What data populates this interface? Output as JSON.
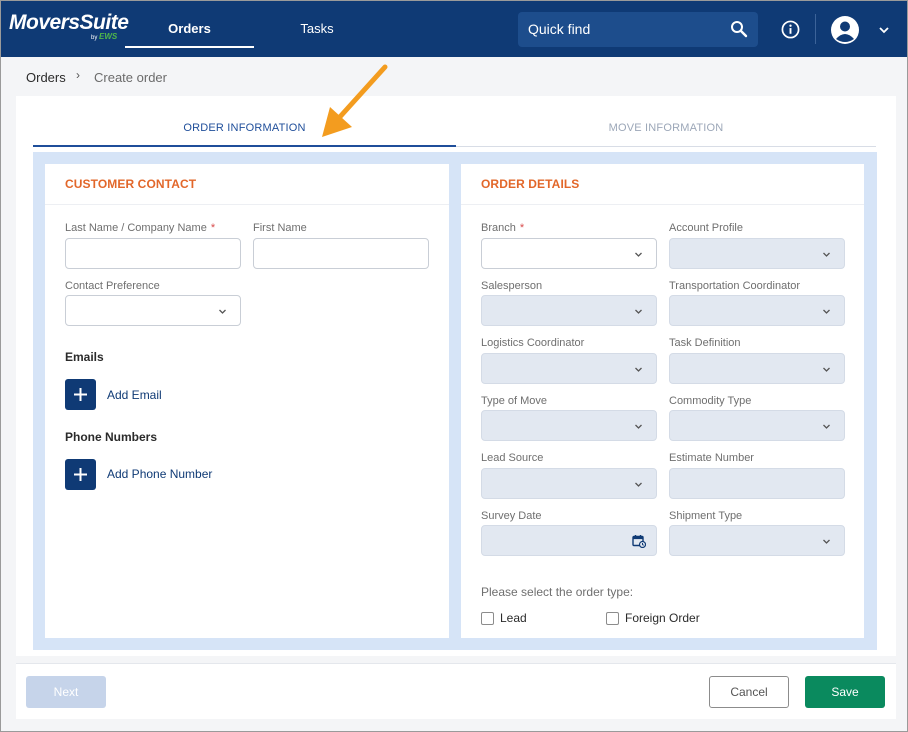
{
  "app": {
    "logo_text": "MoversSuite",
    "logo_sub_by": "by",
    "logo_sub_brand": "EWS"
  },
  "nav": {
    "tabs": [
      {
        "label": "Orders",
        "active": true
      },
      {
        "label": "Tasks",
        "active": false
      }
    ],
    "quick_find": "Quick find",
    "icons": [
      "search-icon",
      "info-icon",
      "user-avatar-icon",
      "chevron-down-icon"
    ]
  },
  "breadcrumb": {
    "root": "Orders",
    "separator": "›",
    "current": "Create order"
  },
  "tabs": [
    {
      "label": "ORDER INFORMATION",
      "active": true
    },
    {
      "label": "MOVE INFORMATION",
      "active": false
    }
  ],
  "customer_contact": {
    "title": "CUSTOMER CONTACT",
    "last_name_label": "Last Name / Company Name",
    "first_name_label": "First Name",
    "contact_pref_label": "Contact Preference",
    "required_marker": "*",
    "emails_heading": "Emails",
    "add_email": "Add Email",
    "phones_heading": "Phone Numbers",
    "add_phone": "Add Phone Number"
  },
  "order_details": {
    "title": "ORDER DETAILS",
    "required_marker": "*",
    "fields": {
      "branch": "Branch",
      "account_profile": "Account Profile",
      "salesperson": "Salesperson",
      "transportation_coordinator": "Transportation Coordinator",
      "logistics_coordinator": "Logistics Coordinator",
      "task_definition": "Task Definition",
      "type_of_move": "Type of Move",
      "commodity_type": "Commodity Type",
      "lead_source": "Lead Source",
      "estimate_number": "Estimate Number",
      "survey_date": "Survey Date",
      "shipment_type": "Shipment Type"
    },
    "order_type_prompt": "Please select the order type:",
    "order_types": [
      {
        "label": "Lead",
        "checked": false
      },
      {
        "label": "Foreign Order",
        "checked": false
      }
    ]
  },
  "footer": {
    "next": "Next",
    "cancel": "Cancel",
    "save": "Save"
  },
  "colors": {
    "nav_bg": "#0f3a75",
    "accent_orange": "#e2672a",
    "save_green": "#0a8a5e",
    "arrow": "#f39c1f"
  }
}
